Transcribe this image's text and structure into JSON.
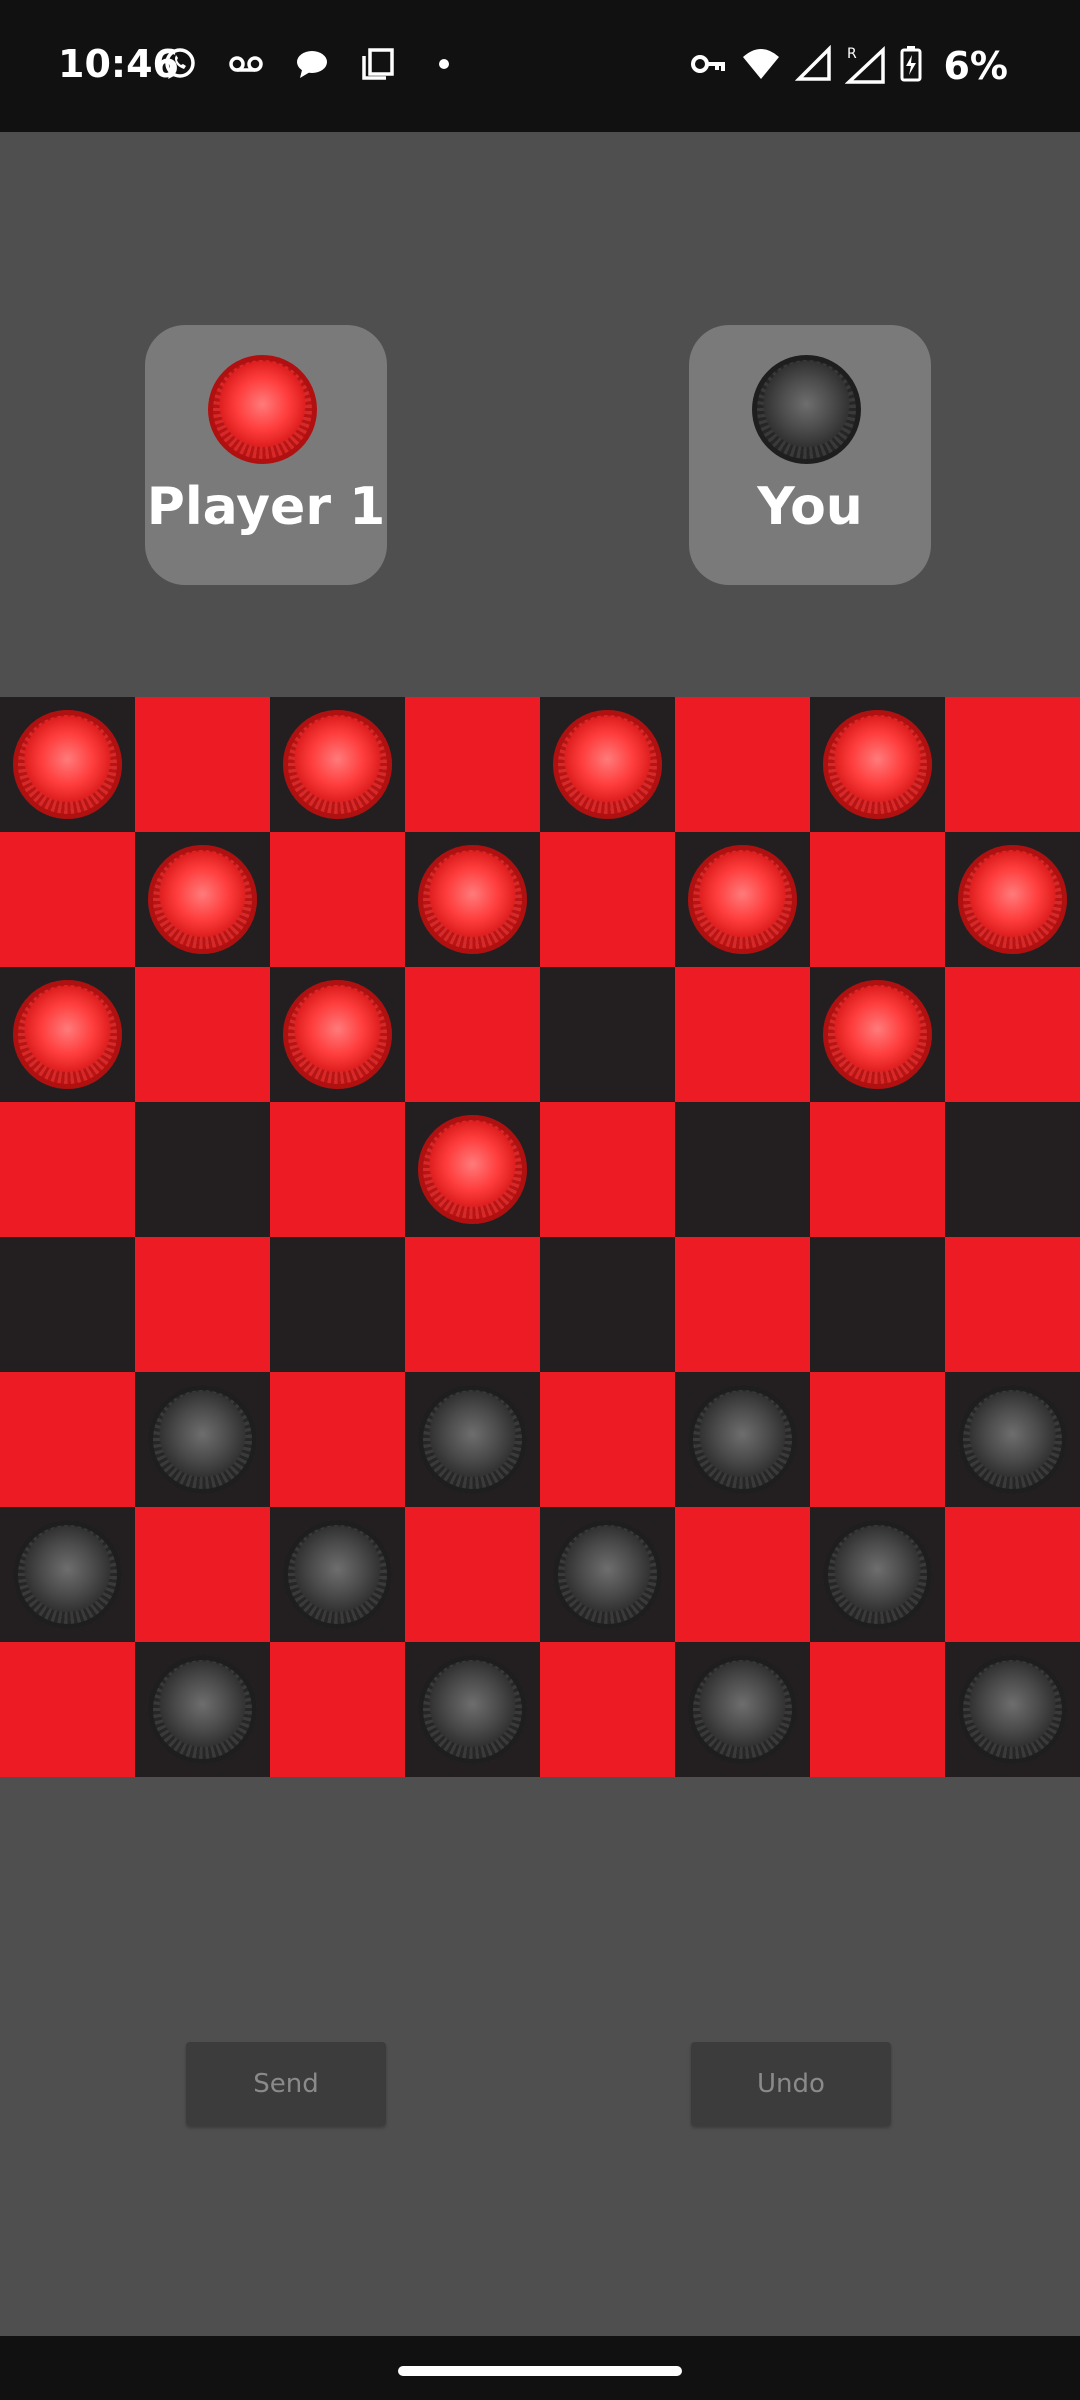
{
  "status_bar": {
    "time": "10:46",
    "battery_percent": "6%",
    "left_icons": [
      "whatsapp-icon",
      "voicemail-icon",
      "chat-bubble-icon",
      "copy-icon",
      "dot-icon"
    ],
    "right_icons": [
      "vpn-key-icon",
      "wifi-icon",
      "signal-icon",
      "roaming-signal-icon",
      "battery-charging-icon"
    ]
  },
  "players": {
    "opponent": {
      "name": "Player 1",
      "color": "red"
    },
    "self": {
      "name": "You",
      "color": "black"
    }
  },
  "board": {
    "size": 8,
    "colors": {
      "dark_square": "#231f20",
      "light_square": "#ed1c24"
    },
    "rows": [
      "R.R.R.R.",
      ".R.R.R.R",
      "R.R...R.",
      "...R....",
      "........",
      ".B.B.B.B",
      "B.B.B.B.",
      ".B.B.B.B"
    ]
  },
  "buttons": {
    "send_label": "Send",
    "undo_label": "Undo"
  }
}
